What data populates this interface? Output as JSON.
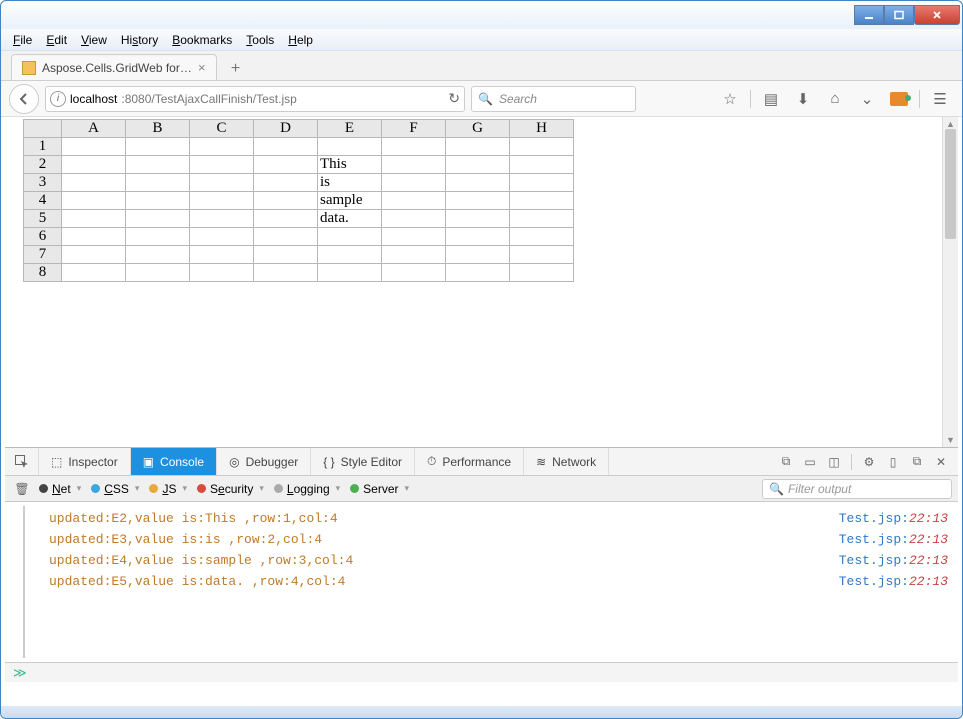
{
  "window": {
    "menus": [
      "File",
      "Edit",
      "View",
      "History",
      "Bookmarks",
      "Tools",
      "Help"
    ]
  },
  "tab": {
    "title": "Aspose.Cells.GridWeb for J..."
  },
  "nav": {
    "host": "localhost",
    "port_path": ":8080/TestAjaxCallFinish/Test.jsp",
    "search_placeholder": "Search"
  },
  "grid": {
    "columns": [
      "A",
      "B",
      "C",
      "D",
      "E",
      "F",
      "G",
      "H"
    ],
    "rows": [
      {
        "n": "1",
        "cells": [
          "",
          "",
          "",
          "",
          "",
          "",
          "",
          ""
        ]
      },
      {
        "n": "2",
        "cells": [
          "",
          "",
          "",
          "",
          "This",
          "",
          "",
          ""
        ]
      },
      {
        "n": "3",
        "cells": [
          "",
          "",
          "",
          "",
          "is",
          "",
          "",
          ""
        ]
      },
      {
        "n": "4",
        "cells": [
          "",
          "",
          "",
          "",
          "sample",
          "",
          "",
          ""
        ]
      },
      {
        "n": "5",
        "cells": [
          "",
          "",
          "",
          "",
          "data.",
          "",
          "",
          ""
        ]
      },
      {
        "n": "6",
        "cells": [
          "",
          "",
          "",
          "",
          "",
          "",
          "",
          ""
        ]
      },
      {
        "n": "7",
        "cells": [
          "",
          "",
          "",
          "",
          "",
          "",
          "",
          ""
        ]
      },
      {
        "n": "8",
        "cells": [
          "",
          "",
          "",
          "",
          "",
          "",
          "",
          ""
        ]
      }
    ]
  },
  "devtools": {
    "tabs": {
      "inspector": "Inspector",
      "console": "Console",
      "debugger": "Debugger",
      "style": "Style Editor",
      "perf": "Performance",
      "network": "Network"
    },
    "filters": {
      "net": "Net",
      "css": "CSS",
      "js": "JS",
      "security": "Security",
      "logging": "Logging",
      "server": "Server"
    },
    "filter_placeholder": "Filter output",
    "logs": [
      {
        "msg": "updated:E2,value is:This ,row:1,col:4",
        "src": "Test.jsp",
        "line": "22:13"
      },
      {
        "msg": "updated:E3,value is:is ,row:2,col:4",
        "src": "Test.jsp",
        "line": "22:13"
      },
      {
        "msg": "updated:E4,value is:sample ,row:3,col:4",
        "src": "Test.jsp",
        "line": "22:13"
      },
      {
        "msg": "updated:E5,value is:data. ,row:4,col:4",
        "src": "Test.jsp",
        "line": "22:13"
      }
    ],
    "expand_glyph": "≫"
  }
}
